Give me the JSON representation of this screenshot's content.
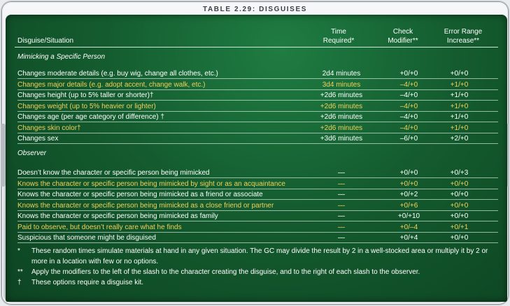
{
  "title": "TABLE 2.29: DISGUISES",
  "headers": {
    "situation": "Disguise/Situation",
    "time": [
      "Time",
      "Required*"
    ],
    "check": [
      "Check",
      "Modifier**"
    ],
    "error": [
      "Error Range",
      "Increase**"
    ]
  },
  "sections": [
    {
      "label": "Mimicking a Specific Person",
      "rows": [
        {
          "text": "Changes moderate details (e.g. buy wig, change all clothes, etc.)",
          "time": "2d4 minutes",
          "check": "+0/+0",
          "error": "+0/+0",
          "highlight": false
        },
        {
          "text": "Changes major details (e.g. adopt accent, change walk, etc.)",
          "time": "3d4 minutes",
          "check": "–4/+0",
          "error": "+1/+0",
          "highlight": true
        },
        {
          "text": "Changes height (up to 5% taller or shorter)†",
          "time": "+2d6 minutes",
          "check": "–4/+0",
          "error": "+1/+0",
          "highlight": false
        },
        {
          "text": "Changes weight (up to 5% heavier or lighter)",
          "time": "+2d6 minutes",
          "check": "–4/+0",
          "error": "+1/+0",
          "highlight": true
        },
        {
          "text": "Changes age (per age category of difference) †",
          "time": "+2d6 minutes",
          "check": "–4/+0",
          "error": "+1/+0",
          "highlight": false
        },
        {
          "text": "Changes skin color†",
          "time": "+2d6 minutes",
          "check": "–4/+0",
          "error": "+1/+0",
          "highlight": true
        },
        {
          "text": "Changes sex",
          "time": "+3d6 minutes",
          "check": "–6/+0",
          "error": "+2/+0",
          "highlight": false
        }
      ]
    },
    {
      "label": "Observer",
      "rows": [
        {
          "text": "Doesn’t know the character or specific person being mimicked",
          "time": "—",
          "check": "+0/+0",
          "error": "+0/+3",
          "highlight": false
        },
        {
          "text": "Knows the character or specific person being mimicked by sight or as an acquaintance",
          "time": "—",
          "check": "+0/+0",
          "error": "+0/+0",
          "highlight": true
        },
        {
          "text": "Knows the character or specific person being mimicked as a friend or associate",
          "time": "—",
          "check": "+0/+2",
          "error": "+0/+0",
          "highlight": false
        },
        {
          "text": "Knows the character or specific person being mimicked as a close friend or partner",
          "time": "—",
          "check": "+0/+6",
          "error": "+0/+0",
          "highlight": true
        },
        {
          "text": "Knows the character or specific person being mimicked as family",
          "time": "—",
          "check": "+0/+10",
          "error": "+0/+0",
          "highlight": false
        },
        {
          "text": "Paid to observe, but doesn’t really care what he finds",
          "time": "—",
          "check": "+0/–4",
          "error": "+0/+1",
          "highlight": true
        },
        {
          "text": "Suspicious that someone might be disguised",
          "time": "—",
          "check": "+0/+4",
          "error": "+0/+0",
          "highlight": false
        }
      ]
    }
  ],
  "notes": [
    {
      "mark": "*",
      "text": "These random times simulate materials at hand in any given situation. The GC may divide the result by 2 in a well-stocked area or multiply it by 2 or more in a location with few or no options."
    },
    {
      "mark": "**",
      "text": "Apply the modifiers to the left of the slash to the character creating the disguise, and to the right of each slash to the observer."
    },
    {
      "mark": "†",
      "text": "These options require a disguise kit."
    }
  ],
  "colors": {
    "panel": "#145c2f",
    "highlight": "#efd25b",
    "text": "#ffffff"
  }
}
